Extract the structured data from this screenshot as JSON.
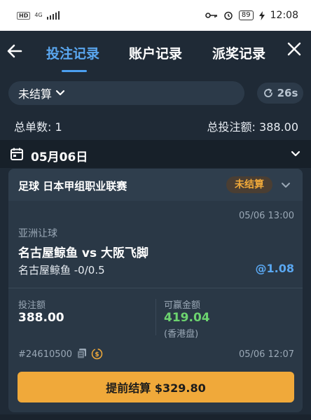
{
  "status_bar": {
    "hd": "HD",
    "network": "4G",
    "time": "12:08",
    "battery": "89"
  },
  "header": {
    "tabs": [
      {
        "label": "投注记录",
        "active": true
      },
      {
        "label": "账户记录",
        "active": false
      },
      {
        "label": "派奖记录",
        "active": false
      }
    ]
  },
  "filter": {
    "selected": "未结算",
    "refresh_countdown": "26s"
  },
  "summary": {
    "order_count": "总单数: 1",
    "total_stake": "总投注额: 388.00"
  },
  "date_group": {
    "date": "05月06日"
  },
  "bet": {
    "league": "足球 日本甲组职业联赛",
    "status": "未结算",
    "bet_time": "05/06 13:00",
    "market": "亚洲让球",
    "match": "名古屋鲸鱼 vs 大阪飞脚",
    "selection": "名古屋鲸鱼 -0/0.5",
    "odds": "@1.08",
    "stake_label": "投注额",
    "stake": "388.00",
    "win_label": "可赢金额",
    "win": "419.04",
    "odds_type": "(香港盘)",
    "ticket_id": "#24610500",
    "ticket_time": "05/06 12:07",
    "cashout_label": "提前结算 $329.80"
  },
  "colors": {
    "background": "#1f2a36",
    "accent_blue": "#5aa7f0",
    "accent_orange": "#f0a93a",
    "win_green": "#6cd36f"
  }
}
